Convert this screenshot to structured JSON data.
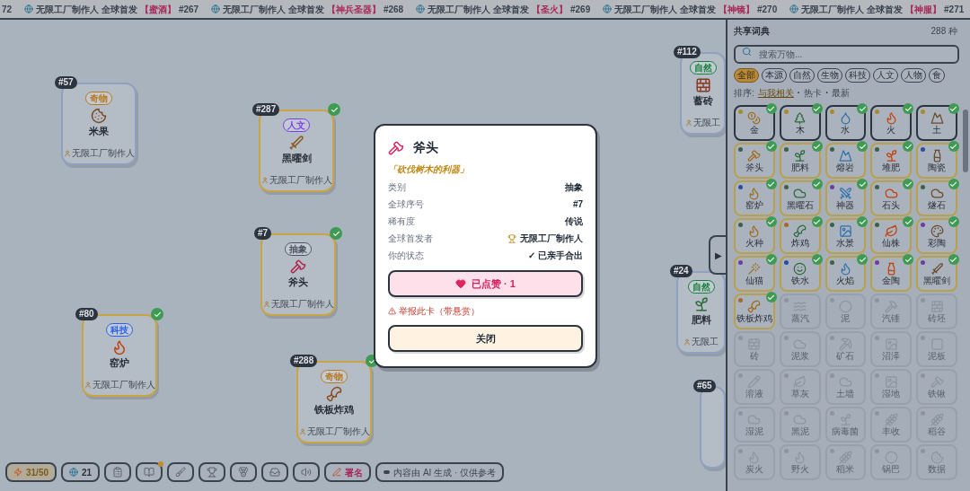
{
  "ticker": {
    "lead": "72",
    "items": [
      {
        "text": "无限工厂制作人 全球首发",
        "name": "【蜜酒】",
        "number": "#267"
      },
      {
        "text": "无限工厂制作人 全球首发",
        "name": "【神兵圣器】",
        "number": "#268"
      },
      {
        "text": "无限工厂制作人 全球首发",
        "name": "【圣火】",
        "number": "#269"
      },
      {
        "text": "无限工厂制作人 全球首发",
        "name": "【神镜】",
        "number": "#270"
      },
      {
        "text": "无限工厂制作人 全球首发",
        "name": "【神服】",
        "number": "#271"
      }
    ]
  },
  "canvas_cards": [
    {
      "number": "#57",
      "tag": "奇物",
      "color": "#b7791f",
      "name": "米果",
      "author": "无限工厂制作人",
      "found": false
    },
    {
      "number": "#287",
      "tag": "人文",
      "color": "#7c3aed",
      "name": "黑曜剑",
      "author": "无限工厂制作人",
      "found": true
    },
    {
      "number": "#7",
      "tag": "抽象",
      "color": "#4b5563",
      "name": "斧头",
      "author": "无限工厂制作人",
      "found": true
    },
    {
      "number": "#80",
      "tag": "科技",
      "color": "#2563eb",
      "name": "窑炉",
      "author": "无限工厂制作人",
      "found": true
    },
    {
      "number": "#288",
      "tag": "奇物",
      "color": "#b7791f",
      "name": "铁板炸鸡",
      "author": "无限工厂制作人",
      "found": true
    },
    {
      "number": "#112",
      "tag": "自然",
      "color": "#15803d",
      "name": "蓄砖",
      "author": "无限工",
      "found": false
    },
    {
      "number": "#24",
      "tag": "自然",
      "color": "#15803d",
      "name": "肥料",
      "author": "无限工",
      "found": false
    },
    {
      "number": "#65",
      "found": false
    }
  ],
  "modal": {
    "title": "斧头",
    "subtitle": "「砍伐树木的利器」",
    "rows": [
      {
        "kind": "plain",
        "label": "类别",
        "value": "抽象"
      },
      {
        "kind": "plain",
        "label": "全球序号",
        "value": "#7"
      },
      {
        "kind": "plain",
        "label": "稀有度",
        "value": "传说"
      },
      {
        "kind": "author",
        "label": "全球首发者",
        "value": "无限工厂制作人"
      },
      {
        "kind": "plain",
        "label": "你的状态",
        "value": "✓ 已亲手合出"
      }
    ],
    "like_button": {
      "label": "已点赞 · 1",
      "liked": true
    },
    "report_link": "举报此卡（带悬赏）",
    "close_button": "关闭"
  },
  "sidebar": {
    "toggle": "▶",
    "title": "共享词典",
    "count": "288 种",
    "search": {
      "placeholder": "搜索万物..."
    },
    "filters": [
      {
        "label": "全部",
        "selected": true
      },
      {
        "label": "本源",
        "selected": false
      },
      {
        "label": "自然",
        "selected": false
      },
      {
        "label": "生物",
        "selected": false
      },
      {
        "label": "科技",
        "selected": false
      },
      {
        "label": "人文",
        "selected": false
      },
      {
        "label": "人物",
        "selected": false
      },
      {
        "label": "食",
        "selected": false
      }
    ],
    "sort_label": "排序:",
    "separators": [
      "·",
      "·"
    ],
    "sorts": [
      {
        "label": "与我相关",
        "selected": true
      },
      {
        "label": "热卡",
        "selected": false
      },
      {
        "label": "最新",
        "selected": false
      }
    ],
    "items": [
      {
        "name": "金",
        "found": true,
        "color": "#a88a2c"
      },
      {
        "name": "木",
        "found": true,
        "color": "#a88a2c"
      },
      {
        "name": "水",
        "found": true,
        "color": "#a88a2c"
      },
      {
        "name": "火",
        "found": true,
        "color": "#a88a2c"
      },
      {
        "name": "土",
        "found": true,
        "color": "#a88a2c"
      },
      {
        "name": "斧头",
        "found": true,
        "color": "#3f5f4a"
      },
      {
        "name": "肥料",
        "found": true,
        "color": "#3f5f4a"
      },
      {
        "name": "熔岩",
        "found": true,
        "color": "#3f5f4a"
      },
      {
        "name": "堆肥",
        "found": true,
        "color": "#3f5f4a"
      },
      {
        "name": "陶瓷",
        "found": true,
        "color": "#2b4fa0"
      },
      {
        "name": "窑炉",
        "found": true,
        "color": "#2b4fa0"
      },
      {
        "name": "黑曜石",
        "found": true,
        "color": "#3f5f4a"
      },
      {
        "name": "神器",
        "found": true,
        "color": "#6b3fa0"
      },
      {
        "name": "石头",
        "found": true,
        "color": "#3f5f4a"
      },
      {
        "name": "燧石",
        "found": true,
        "color": "#3f5f4a"
      },
      {
        "name": "火种",
        "found": true,
        "color": "#3f5f4a"
      },
      {
        "name": "炸鸡",
        "found": true,
        "color": "#a8682c"
      },
      {
        "name": "水景",
        "found": true,
        "color": "#3f5f4a"
      },
      {
        "name": "仙株",
        "found": true,
        "color": "#3f5f4a"
      },
      {
        "name": "彩陶",
        "found": true,
        "color": "#6b3fa0"
      },
      {
        "name": "仙猫",
        "found": true,
        "color": "#6b3fa0"
      },
      {
        "name": "铁水",
        "found": true,
        "color": "#2b4fa0"
      },
      {
        "name": "火焰",
        "found": true,
        "color": "#3f5f4a"
      },
      {
        "name": "金陶",
        "found": true,
        "color": "#6b3fa0"
      },
      {
        "name": "黑曜剑",
        "found": true,
        "color": "#6b3fa0"
      },
      {
        "name": "铁板炸鸡",
        "found": true,
        "color": "#a8682c"
      },
      {
        "name": "蒸汽",
        "found": false,
        "color": "#8d949c"
      },
      {
        "name": "泥",
        "found": false,
        "color": "#8d949c"
      },
      {
        "name": "汽锤",
        "found": false,
        "color": "#8d949c"
      },
      {
        "name": "砖坯",
        "found": false,
        "color": "#8d949c"
      },
      {
        "name": "砖",
        "found": false,
        "color": "#8d949c"
      },
      {
        "name": "泥浆",
        "found": false,
        "color": "#8d949c"
      },
      {
        "name": "矿石",
        "found": false,
        "color": "#8d949c"
      },
      {
        "name": "沼泽",
        "found": false,
        "color": "#8d949c"
      },
      {
        "name": "泥板",
        "found": false,
        "color": "#8d949c"
      },
      {
        "name": "溶液",
        "found": false,
        "color": "#8d949c"
      },
      {
        "name": "草灰",
        "found": false,
        "color": "#8d949c"
      },
      {
        "name": "土墙",
        "found": false,
        "color": "#8d949c"
      },
      {
        "name": "湿地",
        "found": false,
        "color": "#8d949c"
      },
      {
        "name": "铁锹",
        "found": false,
        "color": "#8d949c"
      },
      {
        "name": "湿泥",
        "found": false,
        "color": "#8d949c"
      },
      {
        "name": "黑泥",
        "found": false,
        "color": "#8d949c"
      },
      {
        "name": "病毒菌",
        "found": false,
        "color": "#8d949c"
      },
      {
        "name": "丰收",
        "found": false,
        "color": "#8d949c"
      },
      {
        "name": "稻谷",
        "found": false,
        "color": "#8d949c"
      },
      {
        "name": "炭火",
        "found": false,
        "color": "#8d949c"
      },
      {
        "name": "野火",
        "found": false,
        "color": "#8d949c"
      },
      {
        "name": "稻米",
        "found": false,
        "color": "#8d949c"
      },
      {
        "name": "锅巴",
        "found": false,
        "color": "#8d949c"
      },
      {
        "name": "数据",
        "found": false,
        "color": "#8d949c"
      }
    ]
  },
  "toolbar": [
    {
      "kind": "energy",
      "text": "31/50"
    },
    {
      "kind": "globe",
      "text": "21"
    },
    {
      "kind": "icon",
      "badge": false
    },
    {
      "kind": "icon",
      "badge": true
    },
    {
      "kind": "icon",
      "badge": false
    },
    {
      "kind": "icon",
      "badge": false
    },
    {
      "kind": "icon",
      "badge": false
    },
    {
      "kind": "icon",
      "badge": false
    },
    {
      "kind": "icon",
      "badge": false
    },
    {
      "kind": "sign",
      "text": "署名"
    },
    {
      "kind": "note",
      "text": "内容由 AI 生成 · 仅供参考"
    }
  ]
}
